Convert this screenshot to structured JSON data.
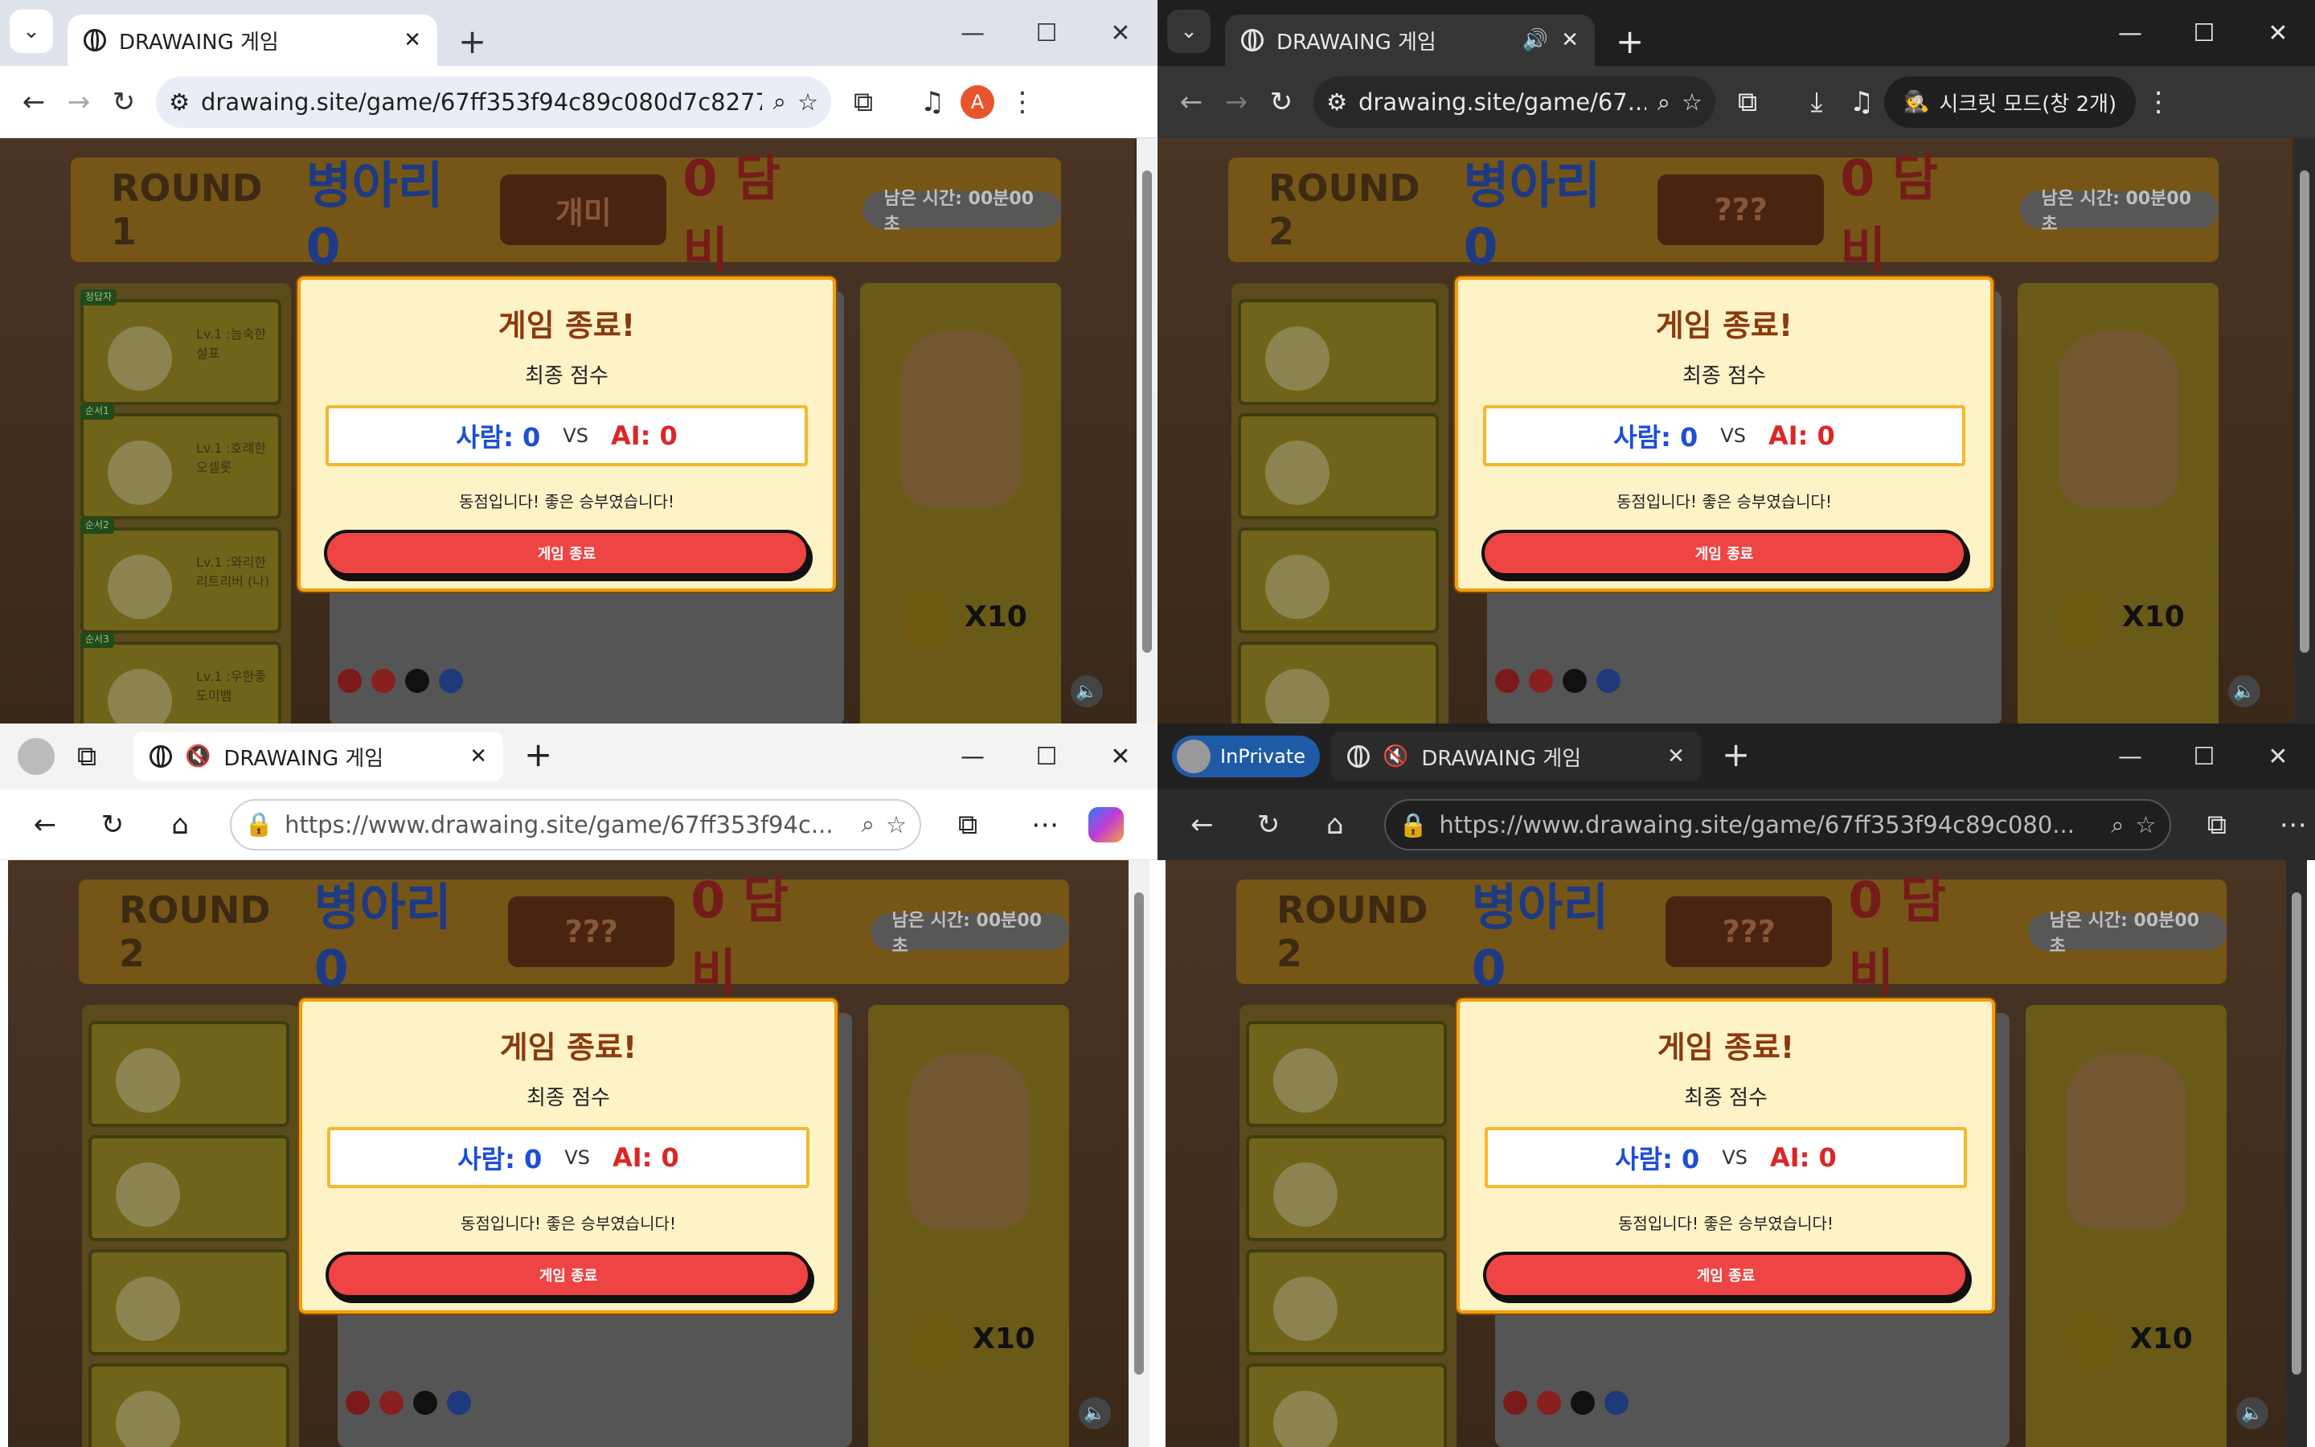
{
  "windows": [
    {
      "id": "tl",
      "tab_title": "DRAWAING 게임",
      "url": "drawaing.site/game/67ff353f94c89c080d7c8277",
      "profile_initial": "A",
      "round": "ROUND 1",
      "team1": "병아리 0",
      "word": "개미",
      "team2": "0 담비",
      "time": "남은 시간: 00분00초"
    },
    {
      "id": "tr",
      "tab_title": "DRAWAING 게임",
      "url": "drawaing.site/game/67...",
      "incognito_label": "시크릿 모드(창 2개)",
      "round": "ROUND 2",
      "team1": "병아리 0",
      "word": "???",
      "team2": "0 담비",
      "time": "남은 시간: 00분00초"
    },
    {
      "id": "bl",
      "tab_title": "DRAWAING 게임",
      "url": "https://www.drawaing.site/game/67ff353f94c...",
      "round": "ROUND 2",
      "team1": "병아리 0",
      "word": "???",
      "team2": "0 담비",
      "time": "남은 시간: 00분00초"
    },
    {
      "id": "br",
      "tab_title": "DRAWAING 게임",
      "url": "https://www.drawaing.site/game/67ff353f94c89c080...",
      "inprivate_label": "InPrivate",
      "round": "ROUND 2",
      "team1": "병아리 0",
      "word": "???",
      "team2": "0 담비",
      "time": "남은 시간: 00분00초"
    }
  ],
  "modal": {
    "title": "게임 종료!",
    "subtitle": "최종 점수",
    "human_score": "사람: 0",
    "vs": "VS",
    "ai_score": "AI: 0",
    "message": "동점입니다! 좋은 승부였습니다!",
    "button": "게임 종료"
  },
  "cards": [
    {
      "badge": "정답자",
      "text": "Lv.1 :늠숙한 설표"
    },
    {
      "badge": "순서1",
      "text": "Lv.1 :호례한 오셀롯"
    },
    {
      "badge": "순서2",
      "text": "Lv.1 :와리한 리트리버 (나)"
    },
    {
      "badge": "순서3",
      "text": "Lv.1 :우한좋 도미뱀"
    }
  ],
  "x10": "X10",
  "palette_colors": [
    "#b91c1c",
    "#dc2626",
    "#111111",
    "#1d4ed8"
  ]
}
